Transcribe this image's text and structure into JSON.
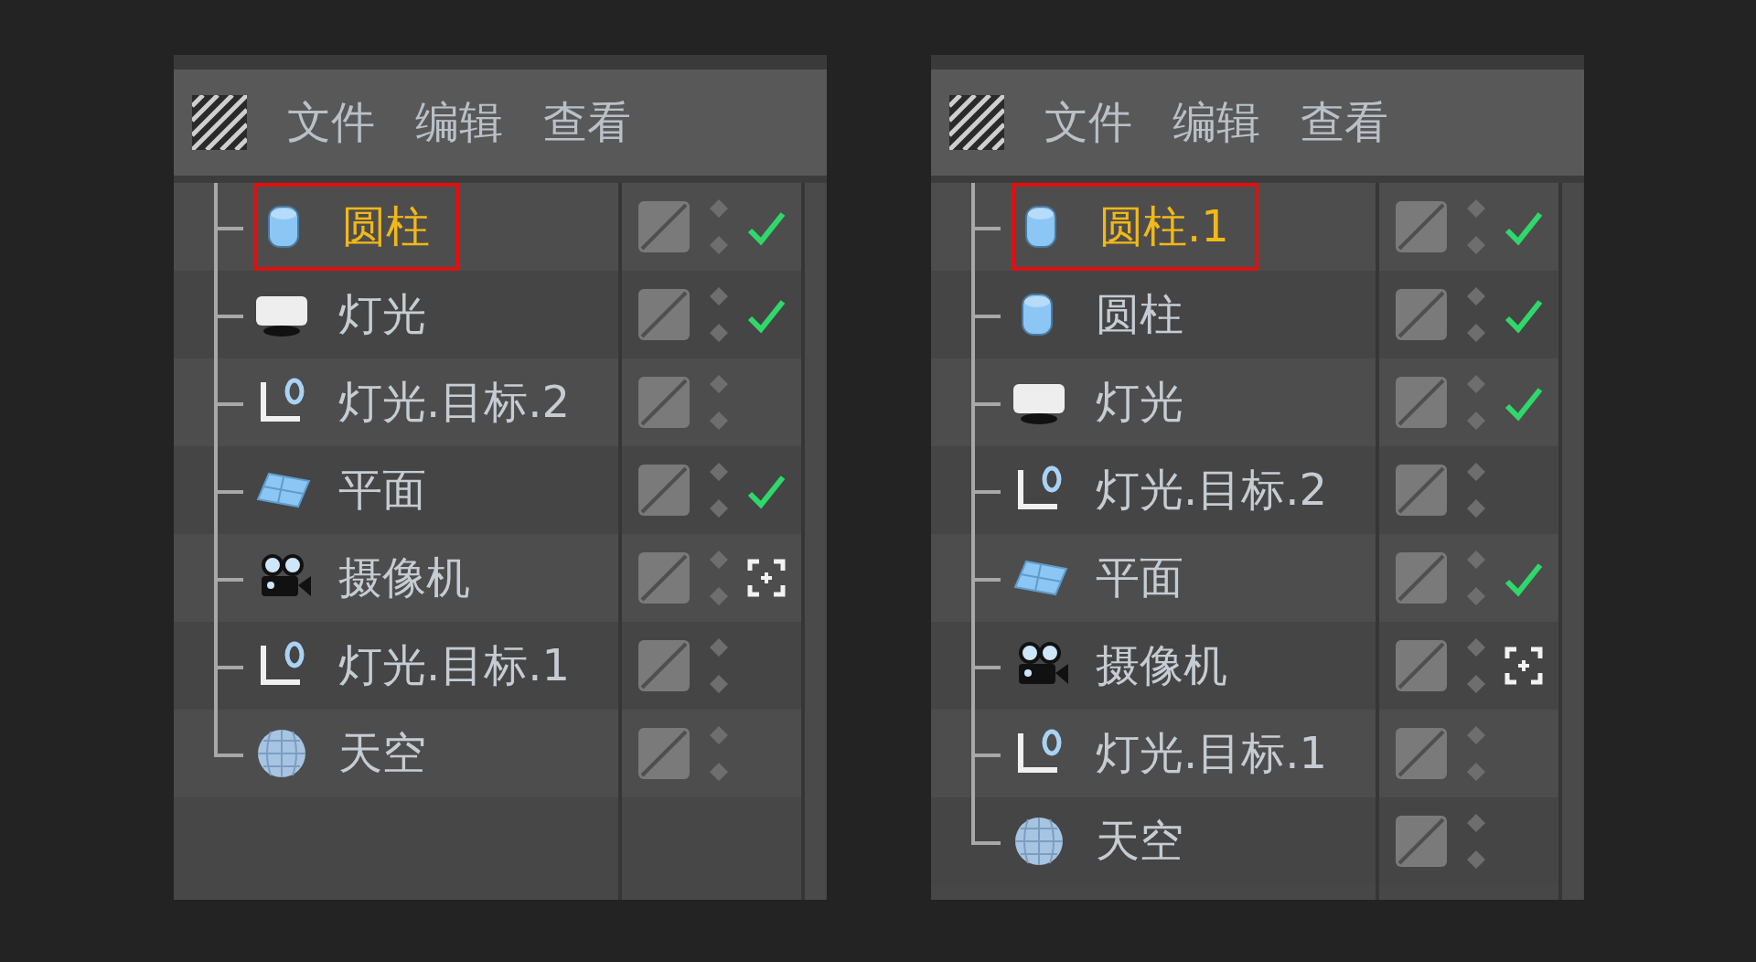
{
  "panels": [
    {
      "menu": [
        "文件",
        "编辑",
        "查看"
      ],
      "objects": [
        {
          "name": "圆柱",
          "kind": "cylinder",
          "selected": true,
          "checked": true
        },
        {
          "name": "灯光",
          "kind": "light",
          "selected": false,
          "checked": true
        },
        {
          "name": "灯光.目标.2",
          "kind": "target",
          "selected": false,
          "checked": false
        },
        {
          "name": "平面",
          "kind": "plane",
          "selected": false,
          "checked": true
        },
        {
          "name": "摄像机",
          "kind": "camera",
          "selected": false,
          "checked": false
        },
        {
          "name": "灯光.目标.1",
          "kind": "target",
          "selected": false,
          "checked": false
        },
        {
          "name": "天空",
          "kind": "sky",
          "selected": false,
          "checked": false
        }
      ]
    },
    {
      "menu": [
        "文件",
        "编辑",
        "查看"
      ],
      "objects": [
        {
          "name": "圆柱.1",
          "kind": "cylinder",
          "selected": true,
          "checked": true
        },
        {
          "name": "圆柱",
          "kind": "cylinder",
          "selected": false,
          "checked": true
        },
        {
          "name": "灯光",
          "kind": "light",
          "selected": false,
          "checked": true
        },
        {
          "name": "灯光.目标.2",
          "kind": "target",
          "selected": false,
          "checked": false
        },
        {
          "name": "平面",
          "kind": "plane",
          "selected": false,
          "checked": true
        },
        {
          "name": "摄像机",
          "kind": "camera",
          "selected": false,
          "checked": false
        },
        {
          "name": "灯光.目标.1",
          "kind": "target",
          "selected": false,
          "checked": false
        },
        {
          "name": "天空",
          "kind": "sky",
          "selected": false,
          "checked": false
        }
      ]
    }
  ]
}
